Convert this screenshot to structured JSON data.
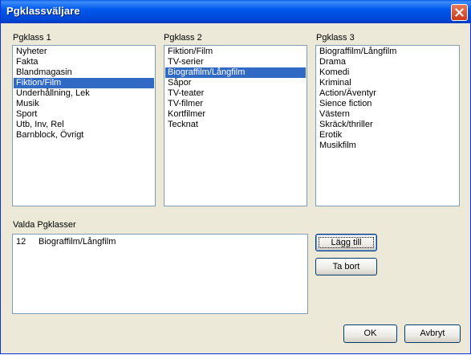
{
  "window": {
    "title": "Pgklassväljare"
  },
  "lists": [
    {
      "label": "Pgklass 1",
      "items": [
        "Nyheter",
        "Fakta",
        "Blandmagasin",
        "Fiktion/Film",
        "Underhållning, Lek",
        "Musik",
        "Sport",
        "Utb, Inv, Rel",
        "Barnblock, Övrigt"
      ],
      "selected": 3
    },
    {
      "label": "Pgklass 2",
      "items": [
        "Fiktion/Film",
        "TV-serier",
        "Biograffilm/Långfilm",
        "Såpor",
        "TV-teater",
        "TV-filmer",
        "Kortfilmer",
        "Tecknat"
      ],
      "selected": 2
    },
    {
      "label": "Pgklass 3",
      "items": [
        "Biograffilm/Långfilm",
        "Drama",
        "Komedi",
        "Kriminal",
        "Action/Äventyr",
        "Sience fiction",
        "Västern",
        "Skräck/thriller",
        "Erotik",
        "Musikfilm"
      ],
      "selected": -1
    }
  ],
  "selected_panel": {
    "label": "Valda Pgklasser",
    "rows": [
      {
        "code": "12",
        "name": "Biograffilm/Långfilm"
      }
    ]
  },
  "buttons": {
    "add": "Lägg till",
    "remove": "Ta bort",
    "ok": "OK",
    "cancel": "Avbryt"
  },
  "colors": {
    "titlebar": "#0054e3",
    "selection": "#316ac5",
    "dialog_bg": "#ece9d8",
    "close_button": "#d3472a"
  },
  "icons": {
    "close": "close-icon"
  }
}
